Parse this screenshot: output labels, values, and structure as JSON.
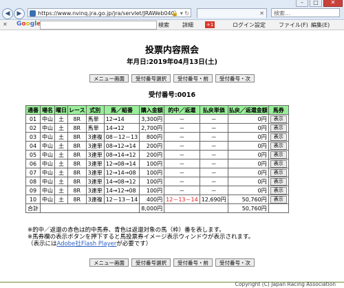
{
  "browser": {
    "url": "https://www.nvinq.jra.go.jp/jra/servlet/JRAWeb040",
    "tab_label": "",
    "search_placeholder": "検索...",
    "toolbar": {
      "close": "✕",
      "google": "Google",
      "search": "検索",
      "details": "詳細",
      "gplus": "+1",
      "login": "ログイン",
      "settings": "設定",
      "file_menu": "ファイル(F)",
      "edit_menu": "編集(E)"
    }
  },
  "page": {
    "title": "投票内容照会",
    "date": "年月日:2019年04月13日(土)",
    "receipt": "受付番号:0016",
    "buttons": [
      "メニュー画面",
      "受付番号選択",
      "受付番号・前",
      "受付番号・次"
    ]
  },
  "table": {
    "headers": [
      "通番",
      "場名",
      "曜日",
      "レース",
      "式別",
      "馬／組番",
      "購入金額",
      "的中／返還",
      "払戻単価",
      "払戻／返還金額",
      "馬券"
    ],
    "rows": [
      {
        "no": "01",
        "place": "中山",
        "day": "土",
        "race": "8R",
        "type": "馬単",
        "combo": "12→14",
        "amount": "3,300円",
        "hit": "－",
        "unit": "－",
        "payout": "0円",
        "btn": "表示"
      },
      {
        "no": "02",
        "place": "中山",
        "day": "土",
        "race": "8R",
        "type": "馬単",
        "combo": "14→12",
        "amount": "2,700円",
        "hit": "－",
        "unit": "－",
        "payout": "0円",
        "btn": "表示"
      },
      {
        "no": "03",
        "place": "中山",
        "day": "土",
        "race": "8R",
        "type": "3連複",
        "combo": "08－12－13",
        "amount": "800円",
        "hit": "－",
        "unit": "－",
        "payout": "0円",
        "btn": "表示"
      },
      {
        "no": "04",
        "place": "中山",
        "day": "土",
        "race": "8R",
        "type": "3連単",
        "combo": "08→12→14",
        "amount": "200円",
        "hit": "－",
        "unit": "－",
        "payout": "0円",
        "btn": "表示"
      },
      {
        "no": "05",
        "place": "中山",
        "day": "土",
        "race": "8R",
        "type": "3連単",
        "combo": "08→14→12",
        "amount": "200円",
        "hit": "－",
        "unit": "－",
        "payout": "0円",
        "btn": "表示"
      },
      {
        "no": "06",
        "place": "中山",
        "day": "土",
        "race": "8R",
        "type": "3連単",
        "combo": "12→08→14",
        "amount": "100円",
        "hit": "－",
        "unit": "－",
        "payout": "0円",
        "btn": "表示"
      },
      {
        "no": "07",
        "place": "中山",
        "day": "土",
        "race": "8R",
        "type": "3連単",
        "combo": "12→14→08",
        "amount": "100円",
        "hit": "－",
        "unit": "－",
        "payout": "0円",
        "btn": "表示"
      },
      {
        "no": "08",
        "place": "中山",
        "day": "土",
        "race": "8R",
        "type": "3連単",
        "combo": "14→08→12",
        "amount": "100円",
        "hit": "－",
        "unit": "－",
        "payout": "0円",
        "btn": "表示"
      },
      {
        "no": "09",
        "place": "中山",
        "day": "土",
        "race": "8R",
        "type": "3連単",
        "combo": "14→12→08",
        "amount": "100円",
        "hit": "－",
        "unit": "－",
        "payout": "0円",
        "btn": "表示"
      },
      {
        "no": "10",
        "place": "中山",
        "day": "土",
        "race": "8R",
        "type": "3連複",
        "combo": "12－13－14",
        "amount": "400円",
        "hit": "12－13－14",
        "unit": "12,690円",
        "payout": "50,760円",
        "btn": "表示",
        "hit_red": true
      }
    ],
    "total": {
      "label": "合計",
      "amount": "8,000円",
      "payout": "50,760円"
    }
  },
  "notes": {
    "line1": "※的中／返還の赤色は的中馬券、青色は返還対象の馬（枠）番を表します。",
    "line2": "※馬券欄の表示ボタンを押下すると馬投票券イメージ表示ウィンドウが表示されます。",
    "line3_prefix": "（表示には",
    "line3_link": "Adobe社Flash Player",
    "line3_suffix": "が必要です）"
  },
  "footer": {
    "copyright": "Copyright (C) Japan Racing Association"
  },
  "colors": {
    "header_green": "#99ee99",
    "hit_red": "#e0181b",
    "link_blue": "#2a5fc9"
  }
}
